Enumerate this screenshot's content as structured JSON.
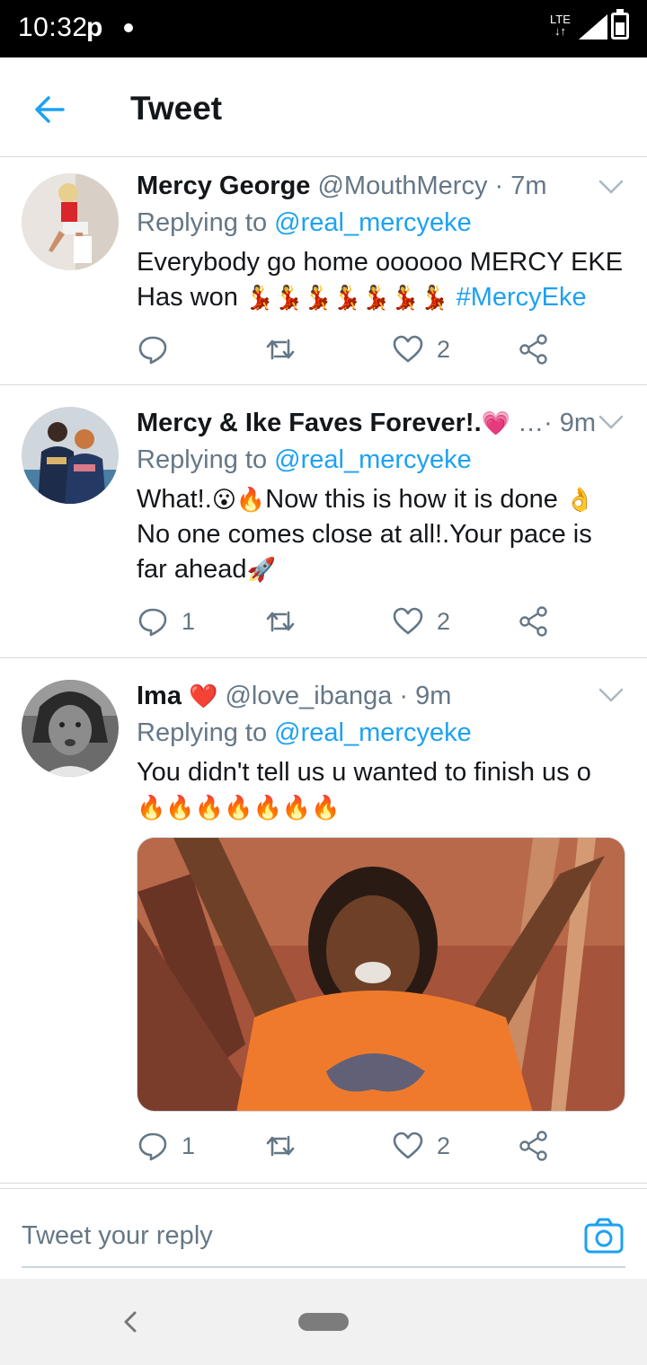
{
  "status_bar": {
    "time": "10:32",
    "carrier_glyph": "p",
    "network": "LTE"
  },
  "header": {
    "title": "Tweet",
    "back_icon": "back-arrow-icon"
  },
  "colors": {
    "accent": "#1da1f2",
    "meta": "#657786",
    "text": "#14171a",
    "divider": "#d6dbdf"
  },
  "tweets": [
    {
      "name": "Mercy George",
      "handle": "@MouthMercy",
      "time": "· 7m",
      "replying_prefix": "Replying to ",
      "replying_to": "@real_mercyeke",
      "text_line1": "Everybody go home oooooo MERCY EKE",
      "text_line2_prefix": "Has won ",
      "text_line2_emoji": "💃💃💃💃💃💃💃",
      "hashtag": "#MercyEke",
      "reply_count": "",
      "like_count": "2"
    },
    {
      "name": "Mercy & Ike Faves Forever!.",
      "name_emoji": "💗",
      "handle": "…",
      "time": "· 9m",
      "replying_prefix": "Replying to ",
      "replying_to": "@real_mercyeke",
      "text_part1": "What!.",
      "emoji1": "😮🔥",
      "text_part2": "Now this is how it is done ",
      "emoji2": "👌",
      "text_part3": "No one comes close at all!.Your pace is far ahead",
      "emoji3": "🚀",
      "reply_count": "1",
      "like_count": "2"
    },
    {
      "name": "Ima",
      "name_emoji": "❤️",
      "handle": "@love_ibanga",
      "time": "· 9m",
      "replying_prefix": "Replying to ",
      "replying_to": "@real_mercyeke",
      "text": "You didn't tell us u wanted to finish us o",
      "emoji": "🔥🔥🔥🔥🔥🔥🔥",
      "reply_count": "1",
      "like_count": "2"
    }
  ],
  "reply_bar": {
    "placeholder": "Tweet your reply",
    "camera_icon": "camera-icon"
  },
  "nav_bar": {
    "back_icon": "nav-back-icon",
    "home_icon": "nav-home-pill"
  }
}
